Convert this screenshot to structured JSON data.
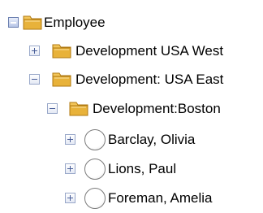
{
  "tree": {
    "nodes": [
      {
        "label": "Employee",
        "icon": "folder-icon",
        "state": "expanded",
        "level": 0
      },
      {
        "label": "Development USA West",
        "icon": "folder-icon",
        "state": "collapsed",
        "level": 1
      },
      {
        "label": "Development: USA East",
        "icon": "folder-icon",
        "state": "expanded",
        "level": 1
      },
      {
        "label": "Development:Boston",
        "icon": "folder-icon",
        "state": "expanded",
        "level": 2
      },
      {
        "label": "Barclay, Olivia",
        "icon": "person-icon",
        "state": "collapsed",
        "level": 3
      },
      {
        "label": "Lions, Paul",
        "icon": "person-icon",
        "state": "collapsed",
        "level": 3
      },
      {
        "label": "Foreman, Amelia",
        "icon": "person-icon",
        "state": "collapsed",
        "level": 3
      }
    ]
  },
  "colors": {
    "folder": "#e8b23a",
    "folder_dark": "#b07a12",
    "toggle_border": "#99a8c9"
  }
}
